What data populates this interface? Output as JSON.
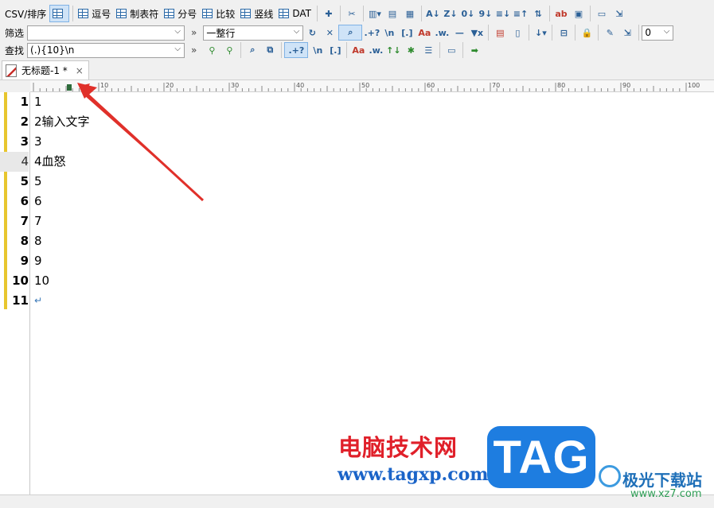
{
  "toolbar1": {
    "csv_sort": "CSV/排序",
    "comma": "逗号",
    "tab": "制表符",
    "semicolon": "分号",
    "compare": "比较",
    "vertical_line": "竖线",
    "dat": "DAT"
  },
  "filter": {
    "label": "筛选",
    "value": "",
    "mode": "一整行",
    "right_value": "0"
  },
  "find": {
    "label": "查找",
    "value": "(.){10}\\n"
  },
  "tab": {
    "title": "无标题-1 *",
    "close": "×"
  },
  "ruler": {
    "ticks": [
      "10",
      "20",
      "30",
      "40",
      "50",
      "60",
      "70",
      "80",
      "90",
      "100"
    ]
  },
  "editor": {
    "lines": [
      {
        "num": "1",
        "text": "1"
      },
      {
        "num": "2",
        "text": "2输入文字"
      },
      {
        "num": "3",
        "text": "3"
      },
      {
        "num": "4",
        "text": "4血怒"
      },
      {
        "num": "5",
        "text": "5"
      },
      {
        "num": "6",
        "text": "6"
      },
      {
        "num": "7",
        "text": "7"
      },
      {
        "num": "8",
        "text": "8"
      },
      {
        "num": "9",
        "text": "9"
      },
      {
        "num": "10",
        "text": "10"
      },
      {
        "num": "11",
        "text": "↵"
      }
    ],
    "current_line": "4"
  },
  "watermark": {
    "title": "电脑技术网",
    "url": "www.tagxp.com",
    "badge": "TAG",
    "site": "极光下载站",
    "site_url": "www.xz7.com"
  },
  "colors": {
    "change_marker": "#e8c62e",
    "arrow": "#e0302a",
    "tag_blue": "#1e7de0"
  }
}
